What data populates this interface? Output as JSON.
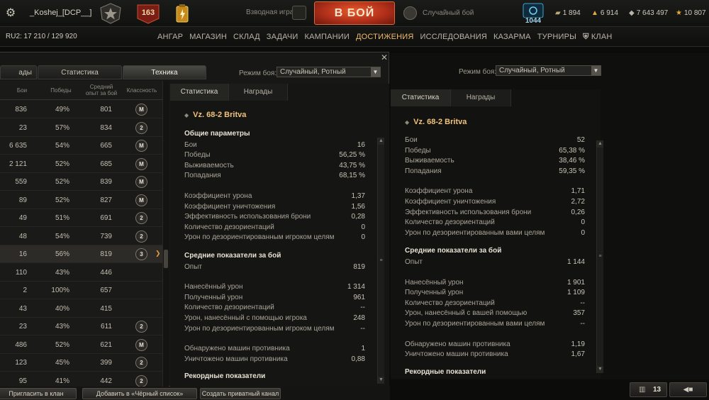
{
  "header": {
    "player_name": "_Koshej_[DCP__]",
    "level": "163",
    "platoon_label": "Взводная игра",
    "battle_button": "В БОЙ",
    "battle_mode": "Случайный бой",
    "premium_days": "1044",
    "currencies": [
      {
        "icon": "bonds-icon",
        "value": "1 894"
      },
      {
        "icon": "gold-icon",
        "value": "6 914"
      },
      {
        "icon": "credits-icon",
        "value": "7 643 497"
      },
      {
        "icon": "free-xp-icon",
        "value": "10 807"
      }
    ]
  },
  "subbar": {
    "server": "RU2: 17 210  /  129 920",
    "nav": [
      "АНГАР",
      "МАГАЗИН",
      "СКЛАД",
      "ЗАДАЧИ",
      "КАМПАНИИ",
      "ДОСТИЖЕНИЯ",
      "ИССЛЕДОВАНИЯ",
      "КАЗАРМА",
      "ТУРНИРЫ",
      "КЛАН"
    ],
    "active": "ДОСТИЖЕНИЯ"
  },
  "win1": {
    "tabs": [
      "ады",
      "Статистика",
      "Техника"
    ],
    "active_tab": "Техника",
    "mode_label": "Режим боя:",
    "mode_value": "Случайный, Ротный",
    "table": {
      "headers": [
        "Бои",
        "Победы",
        "Средний опыт за бой",
        "Классность"
      ],
      "rows": [
        {
          "battles": "836",
          "wins": "49%",
          "xp": "801",
          "mastery": "M"
        },
        {
          "battles": "23",
          "wins": "57%",
          "xp": "834",
          "mastery": "2"
        },
        {
          "battles": "6 635",
          "wins": "54%",
          "xp": "665",
          "mastery": "M"
        },
        {
          "battles": "2 121",
          "wins": "52%",
          "xp": "685",
          "mastery": "M"
        },
        {
          "battles": "559",
          "wins": "52%",
          "xp": "839",
          "mastery": "M"
        },
        {
          "battles": "89",
          "wins": "52%",
          "xp": "827",
          "mastery": "M"
        },
        {
          "battles": "49",
          "wins": "51%",
          "xp": "691",
          "mastery": "2"
        },
        {
          "battles": "48",
          "wins": "54%",
          "xp": "739",
          "mastery": "2"
        },
        {
          "battles": "16",
          "wins": "56%",
          "xp": "819",
          "mastery": "3",
          "selected": true
        },
        {
          "battles": "110",
          "wins": "43%",
          "xp": "446",
          "mastery": ""
        },
        {
          "battles": "2",
          "wins": "100%",
          "xp": "657",
          "mastery": ""
        },
        {
          "battles": "43",
          "wins": "40%",
          "xp": "415",
          "mastery": ""
        },
        {
          "battles": "23",
          "wins": "43%",
          "xp": "611",
          "mastery": "2"
        },
        {
          "battles": "486",
          "wins": "52%",
          "xp": "621",
          "mastery": "M"
        },
        {
          "battles": "123",
          "wins": "45%",
          "xp": "399",
          "mastery": "2"
        },
        {
          "battles": "95",
          "wins": "41%",
          "xp": "442",
          "mastery": "2"
        }
      ]
    },
    "panel": {
      "tabs": [
        "Статистика",
        "Награды"
      ],
      "vehicle": "Vz. 68-2 Britva",
      "general_title": "Общие параметры",
      "general": [
        {
          "label": "Бои",
          "value": "16"
        },
        {
          "label": "Победы",
          "value": "56,25 %"
        },
        {
          "label": "Выживаемость",
          "value": "43,75 %"
        },
        {
          "label": "Попадания",
          "value": "68,15 %"
        }
      ],
      "ratios": [
        {
          "label": "Коэффициент урона",
          "value": "1,37"
        },
        {
          "label": "Коэффициент уничтожения",
          "value": "1,56"
        },
        {
          "label": "Эффективность использования брони",
          "value": "0,28"
        },
        {
          "label": "Количество дезориентаций",
          "value": "0"
        },
        {
          "label": "Урон по дезориентированным игроком целям",
          "value": "0"
        }
      ],
      "avg_title": "Средние показатели за бой",
      "avg_xp": [
        {
          "label": "Опыт",
          "value": "819"
        }
      ],
      "avg_damage": [
        {
          "label": "Нанесённый урон",
          "value": "1 314"
        },
        {
          "label": "Полученный урон",
          "value": "961"
        },
        {
          "label": "Количество дезориентаций",
          "value": "--"
        },
        {
          "label": "Урон, нанесённый с помощью игрока",
          "value": "248"
        },
        {
          "label": "Урон по дезориентированным игроком целям",
          "value": "--"
        }
      ],
      "avg_spot": [
        {
          "label": "Обнаружено машин противника",
          "value": "1"
        },
        {
          "label": "Уничтожено машин противника",
          "value": "0,88"
        }
      ],
      "records_title": "Рекордные показатели"
    }
  },
  "win2": {
    "mode_label": "Режим боя:",
    "mode_value": "Случайный, Ротный",
    "panel": {
      "tabs": [
        "Статистика",
        "Награды"
      ],
      "vehicle": "Vz. 68-2 Britva",
      "general": [
        {
          "label": "Бои",
          "value": "52"
        },
        {
          "label": "Победы",
          "value": "65,38 %"
        },
        {
          "label": "Выживаемость",
          "value": "38,46 %"
        },
        {
          "label": "Попадания",
          "value": "59,35 %"
        }
      ],
      "ratios": [
        {
          "label": "Коэффициент урона",
          "value": "1,71"
        },
        {
          "label": "Коэффициент уничтожения",
          "value": "2,72"
        },
        {
          "label": "Эффективность использования брони",
          "value": "0,26"
        },
        {
          "label": "Количество дезориентаций",
          "value": "0"
        },
        {
          "label": "Урон по дезориентированным вами целям",
          "value": "0"
        }
      ],
      "avg_title": "Средние показатели за бой",
      "avg_xp": [
        {
          "label": "Опыт",
          "value": "1 144"
        }
      ],
      "avg_damage": [
        {
          "label": "Нанесённый урон",
          "value": "1 901"
        },
        {
          "label": "Полученный урон",
          "value": "1 109"
        },
        {
          "label": "Количество дезориентаций",
          "value": "--"
        },
        {
          "label": "Урон, нанесённый с вашей помощью",
          "value": "357"
        },
        {
          "label": "Урон по дезориентированным вами целям",
          "value": "--"
        }
      ],
      "avg_spot": [
        {
          "label": "Обнаружено машин противника",
          "value": "1,19"
        },
        {
          "label": "Уничтожено машин противника",
          "value": "1,67"
        }
      ],
      "records_title": "Рекордные показатели"
    }
  },
  "bottom": {
    "buttons": [
      "Пригласить в клан",
      "Добавить в «Чёрный список»",
      "Создать приватный канал"
    ],
    "notifications": "13"
  },
  "colors": {
    "accent": "#f0ba6a",
    "battle": "#c0391d",
    "vehicle_title": "#f0c27a"
  }
}
